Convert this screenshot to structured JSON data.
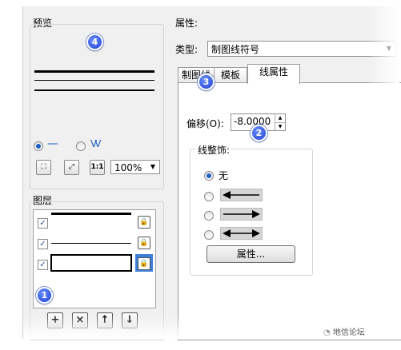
{
  "preview": {
    "title": "预览",
    "style_symbols": [
      "—",
      "VV"
    ],
    "zoom_buttons": [
      "zoom-fit",
      "zoom-extent",
      "1:1"
    ],
    "zoom_value": "100%"
  },
  "layers": {
    "title": "图层",
    "rows": [
      {
        "checked": true,
        "style": "thick-line"
      },
      {
        "checked": true,
        "style": "thin-line"
      },
      {
        "checked": true,
        "style": "empty",
        "selected": true
      }
    ],
    "buttons": [
      "+",
      "×",
      "↑",
      "↓"
    ]
  },
  "properties": {
    "title": "属性:",
    "type_label": "类型:",
    "type_value": "制图线符号",
    "tabs": [
      "制图线",
      "模板",
      "线属性"
    ],
    "active_tab": "线属性",
    "offset_label": "偏移(O):",
    "offset_value": "-8.0000",
    "decoration_title": "线整饰:",
    "decoration_none": "无",
    "decoration_options": [
      "无",
      "arrow-left",
      "arrow-right",
      "arrow-both"
    ],
    "properties_button": "属性..."
  },
  "badges": [
    "4",
    "3",
    "2",
    "1"
  ],
  "watermark": "地信论坛",
  "colors": {
    "accent": "#1d5fc2",
    "badge": "#2a4fe0",
    "selection": "#3b7fd9"
  }
}
